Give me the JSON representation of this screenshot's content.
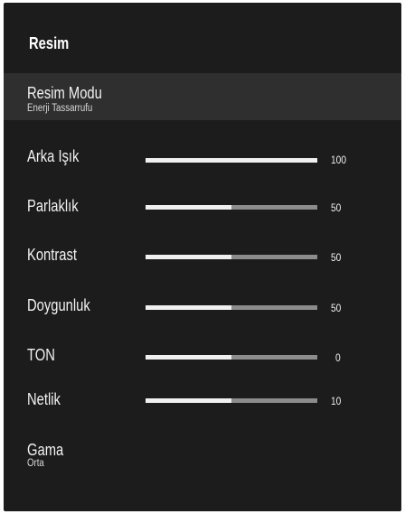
{
  "header": {
    "title": "Resim"
  },
  "items": [
    {
      "label": "Resim Modu",
      "sub": "Enerji Tassarrufu",
      "selected": true
    },
    {
      "label": "Arka Işık",
      "value": "100",
      "fill": 1.0
    },
    {
      "label": "Parlaklık",
      "value": "50",
      "fill": 0.5
    },
    {
      "label": "Kontrast",
      "value": "50",
      "fill": 0.5
    },
    {
      "label": "Doygunluk",
      "value": "50",
      "fill": 0.5
    },
    {
      "label": "TON",
      "value": "0",
      "fill": 0.5
    },
    {
      "label": "Netlik",
      "value": "10",
      "fill": 0.5
    },
    {
      "label": "Gama",
      "sub": "Orta"
    }
  ],
  "colors": {
    "panel_bg": "#1c1c1c",
    "selected_bg": "#2f2f2f",
    "slider_fill": "#f0f0f0",
    "slider_track": "#8c8c8c"
  }
}
